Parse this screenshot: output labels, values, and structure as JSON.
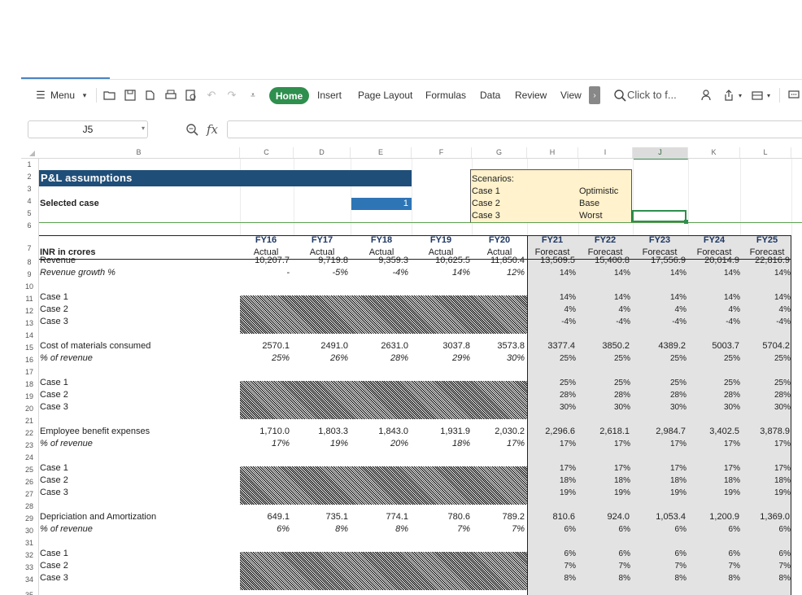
{
  "toolbar": {
    "menu_label": "Menu",
    "tabs": [
      "Home",
      "Insert",
      "Page Layout",
      "Formulas",
      "Data",
      "Review",
      "View"
    ],
    "search_placeholder": "Click to f...",
    "accent": "#2f8f4e"
  },
  "formula_bar": {
    "name_box": "J5",
    "fx_label": "fx",
    "formula": ""
  },
  "columns": [
    "B",
    "C",
    "D",
    "E",
    "F",
    "G",
    "H",
    "I",
    "J",
    "K",
    "L"
  ],
  "rows": [
    "1",
    "2",
    "3",
    "4",
    "5",
    "6",
    "7",
    "8",
    "9",
    "10",
    "11",
    "12",
    "13",
    "14",
    "15",
    "16",
    "17",
    "18",
    "19",
    "20",
    "21",
    "22",
    "23",
    "24",
    "25",
    "26",
    "27",
    "28",
    "29",
    "30",
    "31",
    "32",
    "33",
    "34",
    "35"
  ],
  "sheet": {
    "title": "P&L assumptions",
    "selected_case_label": "Selected case",
    "selected_case_value": "1",
    "scenarios": {
      "heading": "Scenarios:",
      "items": [
        {
          "case": "Case 1",
          "name": "Optimistic"
        },
        {
          "case": "Case 2",
          "name": "Base"
        },
        {
          "case": "Case 3",
          "name": "Worst"
        }
      ]
    },
    "unit_label": "INR in crores",
    "years": [
      "FY16",
      "FY17",
      "FY18",
      "FY19",
      "FY20",
      "FY21",
      "FY22",
      "FY23",
      "FY24",
      "FY25"
    ],
    "year_types": [
      "Actual",
      "Actual",
      "Actual",
      "Actual",
      "Actual",
      "Forecast",
      "Forecast",
      "Forecast",
      "Forecast",
      "Forecast"
    ],
    "lines": [
      {
        "row": 8,
        "label": "Revenue",
        "italic": false,
        "values": [
          "10,207.7",
          "9,719.8",
          "9,359.3",
          "10,625.5",
          "11,850.4",
          "13,509.5",
          "15,400.8",
          "17,556.9",
          "20,014.9",
          "22,816.9"
        ]
      },
      {
        "row": 9,
        "label": "Revenue growth %",
        "italic": true,
        "values": [
          "-",
          "-5%",
          "-4%",
          "14%",
          "12%",
          "14%",
          "14%",
          "14%",
          "14%",
          "14%"
        ]
      },
      {
        "row": 11,
        "label": "Case 1",
        "italic": false,
        "values": [
          "",
          "",
          "",
          "",
          "",
          "14%",
          "14%",
          "14%",
          "14%",
          "14%"
        ]
      },
      {
        "row": 12,
        "label": "Case 2",
        "italic": false,
        "values": [
          "",
          "",
          "",
          "",
          "",
          "4%",
          "4%",
          "4%",
          "4%",
          "4%"
        ]
      },
      {
        "row": 13,
        "label": "Case 3",
        "italic": false,
        "values": [
          "",
          "",
          "",
          "",
          "",
          "-4%",
          "-4%",
          "-4%",
          "-4%",
          "-4%"
        ]
      },
      {
        "row": 15,
        "label": "Cost of materials consumed",
        "italic": false,
        "values": [
          "2570.1",
          "2491.0",
          "2631.0",
          "3037.8",
          "3573.8",
          "3377.4",
          "3850.2",
          "4389.2",
          "5003.7",
          "5704.2"
        ]
      },
      {
        "row": 16,
        "label": "% of revenue",
        "italic": true,
        "values": [
          "25%",
          "26%",
          "28%",
          "29%",
          "30%",
          "25%",
          "25%",
          "25%",
          "25%",
          "25%"
        ]
      },
      {
        "row": 18,
        "label": "Case 1",
        "italic": false,
        "values": [
          "",
          "",
          "",
          "",
          "",
          "25%",
          "25%",
          "25%",
          "25%",
          "25%"
        ]
      },
      {
        "row": 19,
        "label": "Case 2",
        "italic": false,
        "values": [
          "",
          "",
          "",
          "",
          "",
          "28%",
          "28%",
          "28%",
          "28%",
          "28%"
        ]
      },
      {
        "row": 20,
        "label": "Case 3",
        "italic": false,
        "values": [
          "",
          "",
          "",
          "",
          "",
          "30%",
          "30%",
          "30%",
          "30%",
          "30%"
        ]
      },
      {
        "row": 22,
        "label": "Employee benefit expenses",
        "italic": false,
        "values": [
          "1,710.0",
          "1,803.3",
          "1,843.0",
          "1,931.9",
          "2,030.2",
          "2,296.6",
          "2,618.1",
          "2,984.7",
          "3,402.5",
          "3,878.9"
        ]
      },
      {
        "row": 23,
        "label": "% of revenue",
        "italic": true,
        "values": [
          "17%",
          "19%",
          "20%",
          "18%",
          "17%",
          "17%",
          "17%",
          "17%",
          "17%",
          "17%"
        ]
      },
      {
        "row": 25,
        "label": "Case 1",
        "italic": false,
        "values": [
          "",
          "",
          "",
          "",
          "",
          "17%",
          "17%",
          "17%",
          "17%",
          "17%"
        ]
      },
      {
        "row": 26,
        "label": "Case 2",
        "italic": false,
        "values": [
          "",
          "",
          "",
          "",
          "",
          "18%",
          "18%",
          "18%",
          "18%",
          "18%"
        ]
      },
      {
        "row": 27,
        "label": "Case 3",
        "italic": false,
        "values": [
          "",
          "",
          "",
          "",
          "",
          "19%",
          "19%",
          "19%",
          "19%",
          "19%"
        ]
      },
      {
        "row": 29,
        "label": "Depriciation and Amortization",
        "italic": false,
        "values": [
          "649.1",
          "735.1",
          "774.1",
          "780.6",
          "789.2",
          "810.6",
          "924.0",
          "1,053.4",
          "1,200.9",
          "1,369.0"
        ]
      },
      {
        "row": 30,
        "label": "% of revenue",
        "italic": true,
        "values": [
          "6%",
          "8%",
          "8%",
          "7%",
          "7%",
          "6%",
          "6%",
          "6%",
          "6%",
          "6%"
        ]
      },
      {
        "row": 32,
        "label": "Case 1",
        "italic": false,
        "values": [
          "",
          "",
          "",
          "",
          "",
          "6%",
          "6%",
          "6%",
          "6%",
          "6%"
        ]
      },
      {
        "row": 33,
        "label": "Case 2",
        "italic": false,
        "values": [
          "",
          "",
          "",
          "",
          "",
          "7%",
          "7%",
          "7%",
          "7%",
          "7%"
        ]
      },
      {
        "row": 34,
        "label": "Case 3",
        "italic": false,
        "values": [
          "",
          "",
          "",
          "",
          "",
          "8%",
          "8%",
          "8%",
          "8%",
          "8%"
        ]
      }
    ]
  }
}
